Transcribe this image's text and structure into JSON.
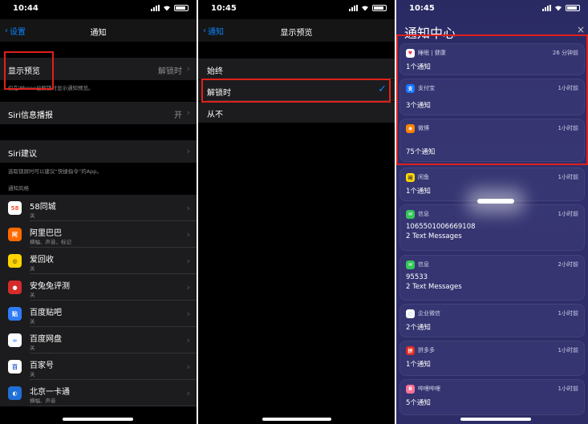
{
  "panel1": {
    "status_time": "10:44",
    "nav_back": "设置",
    "nav_title": "通知",
    "show_preview_label": "显示预览",
    "show_preview_value": "解锁时",
    "show_preview_note": "仅在iPhone已解锁时显示通知预览。",
    "siri_announce_label": "Siri信息播报",
    "siri_announce_value": "开",
    "siri_suggest_label": "Siri建议",
    "siri_note": "选取锁屏时可以建议“快捷指令”的App。",
    "section_header": "通知风格",
    "apps": [
      {
        "name": "58同城",
        "sub": "关",
        "icon_text": "58",
        "icon_bg": "#ffffff",
        "icon_fg": "#ff552e"
      },
      {
        "name": "阿里巴巴",
        "sub": "横幅、声音、标记",
        "icon_text": "阿",
        "icon_bg": "#ff6a00",
        "icon_fg": "#ffffff"
      },
      {
        "name": "爱回收",
        "sub": "关",
        "icon_text": "◎",
        "icon_bg": "#ffd400",
        "icon_fg": "#222222"
      },
      {
        "name": "安兔兔评测",
        "sub": "关",
        "icon_text": "●",
        "icon_bg": "#d62b2b",
        "icon_fg": "#ffffff"
      },
      {
        "name": "百度贴吧",
        "sub": "关",
        "icon_text": "贴",
        "icon_bg": "#2f7cf6",
        "icon_fg": "#ffffff"
      },
      {
        "name": "百度网盘",
        "sub": "关",
        "icon_text": "∞",
        "icon_bg": "#ffffff",
        "icon_fg": "#2a8cff"
      },
      {
        "name": "百家号",
        "sub": "关",
        "icon_text": "百",
        "icon_bg": "#ffffff",
        "icon_fg": "#2052d8"
      },
      {
        "name": "北京一卡通",
        "sub": "横幅、声音",
        "icon_text": "◐",
        "icon_bg": "#1f6fd6",
        "icon_fg": "#ffffff"
      }
    ]
  },
  "panel2": {
    "status_time": "10:45",
    "nav_back": "通知",
    "nav_title": "显示预览",
    "options": [
      "始终",
      "解锁时",
      "从不"
    ],
    "selected_index": 1
  },
  "panel3": {
    "status_time": "10:45",
    "title": "通知中心",
    "close": "×",
    "cards": [
      {
        "app": "睡眠 | 健康",
        "time": "26 分钟前",
        "line1": "1个通知",
        "line2": "",
        "icon_text": "♥",
        "icon_bg": "#ffffff",
        "icon_fg": "#ff2d55"
      },
      {
        "app": "支付宝",
        "time": "1小时前",
        "line1": "3个通知",
        "line2": "",
        "icon_text": "支",
        "icon_bg": "#1677ff",
        "icon_fg": "#ffffff"
      },
      {
        "app": "微博",
        "time": "1小时前",
        "line1": "75个通知",
        "line2": "",
        "icon_text": "◉",
        "icon_bg": "#ff8200",
        "icon_fg": "#ffffff"
      },
      {
        "app": "闲鱼",
        "time": "1小时前",
        "line1": "1个通知",
        "line2": "",
        "icon_text": "闲",
        "icon_bg": "#ffda00",
        "icon_fg": "#333333"
      },
      {
        "app": "信息",
        "time": "1小时前",
        "line1": "1065501006669108",
        "line2": "2 Text Messages",
        "icon_text": "✉",
        "icon_bg": "#34c759",
        "icon_fg": "#ffffff"
      },
      {
        "app": "信息",
        "time": "2小时前",
        "line1": "95533",
        "line2": "2 Text Messages",
        "icon_text": "✉",
        "icon_bg": "#34c759",
        "icon_fg": "#ffffff"
      },
      {
        "app": "企业微信",
        "time": "1小时前",
        "line1": "2个通知",
        "line2": "",
        "icon_text": "◌",
        "icon_bg": "#ffffff",
        "icon_fg": "#2b7cf0"
      },
      {
        "app": "拼多多",
        "time": "1小时前",
        "line1": "1个通知",
        "line2": "",
        "icon_text": "拼",
        "icon_bg": "#e02e24",
        "icon_fg": "#ffffff"
      },
      {
        "app": "哔哩哔哩",
        "time": "1小时前",
        "line1": "5个通知",
        "line2": "",
        "icon_text": "B",
        "icon_bg": "#fb7299",
        "icon_fg": "#ffffff"
      }
    ]
  },
  "colors": {
    "accent": "#0a84ff",
    "highlight": "#e0201a"
  }
}
